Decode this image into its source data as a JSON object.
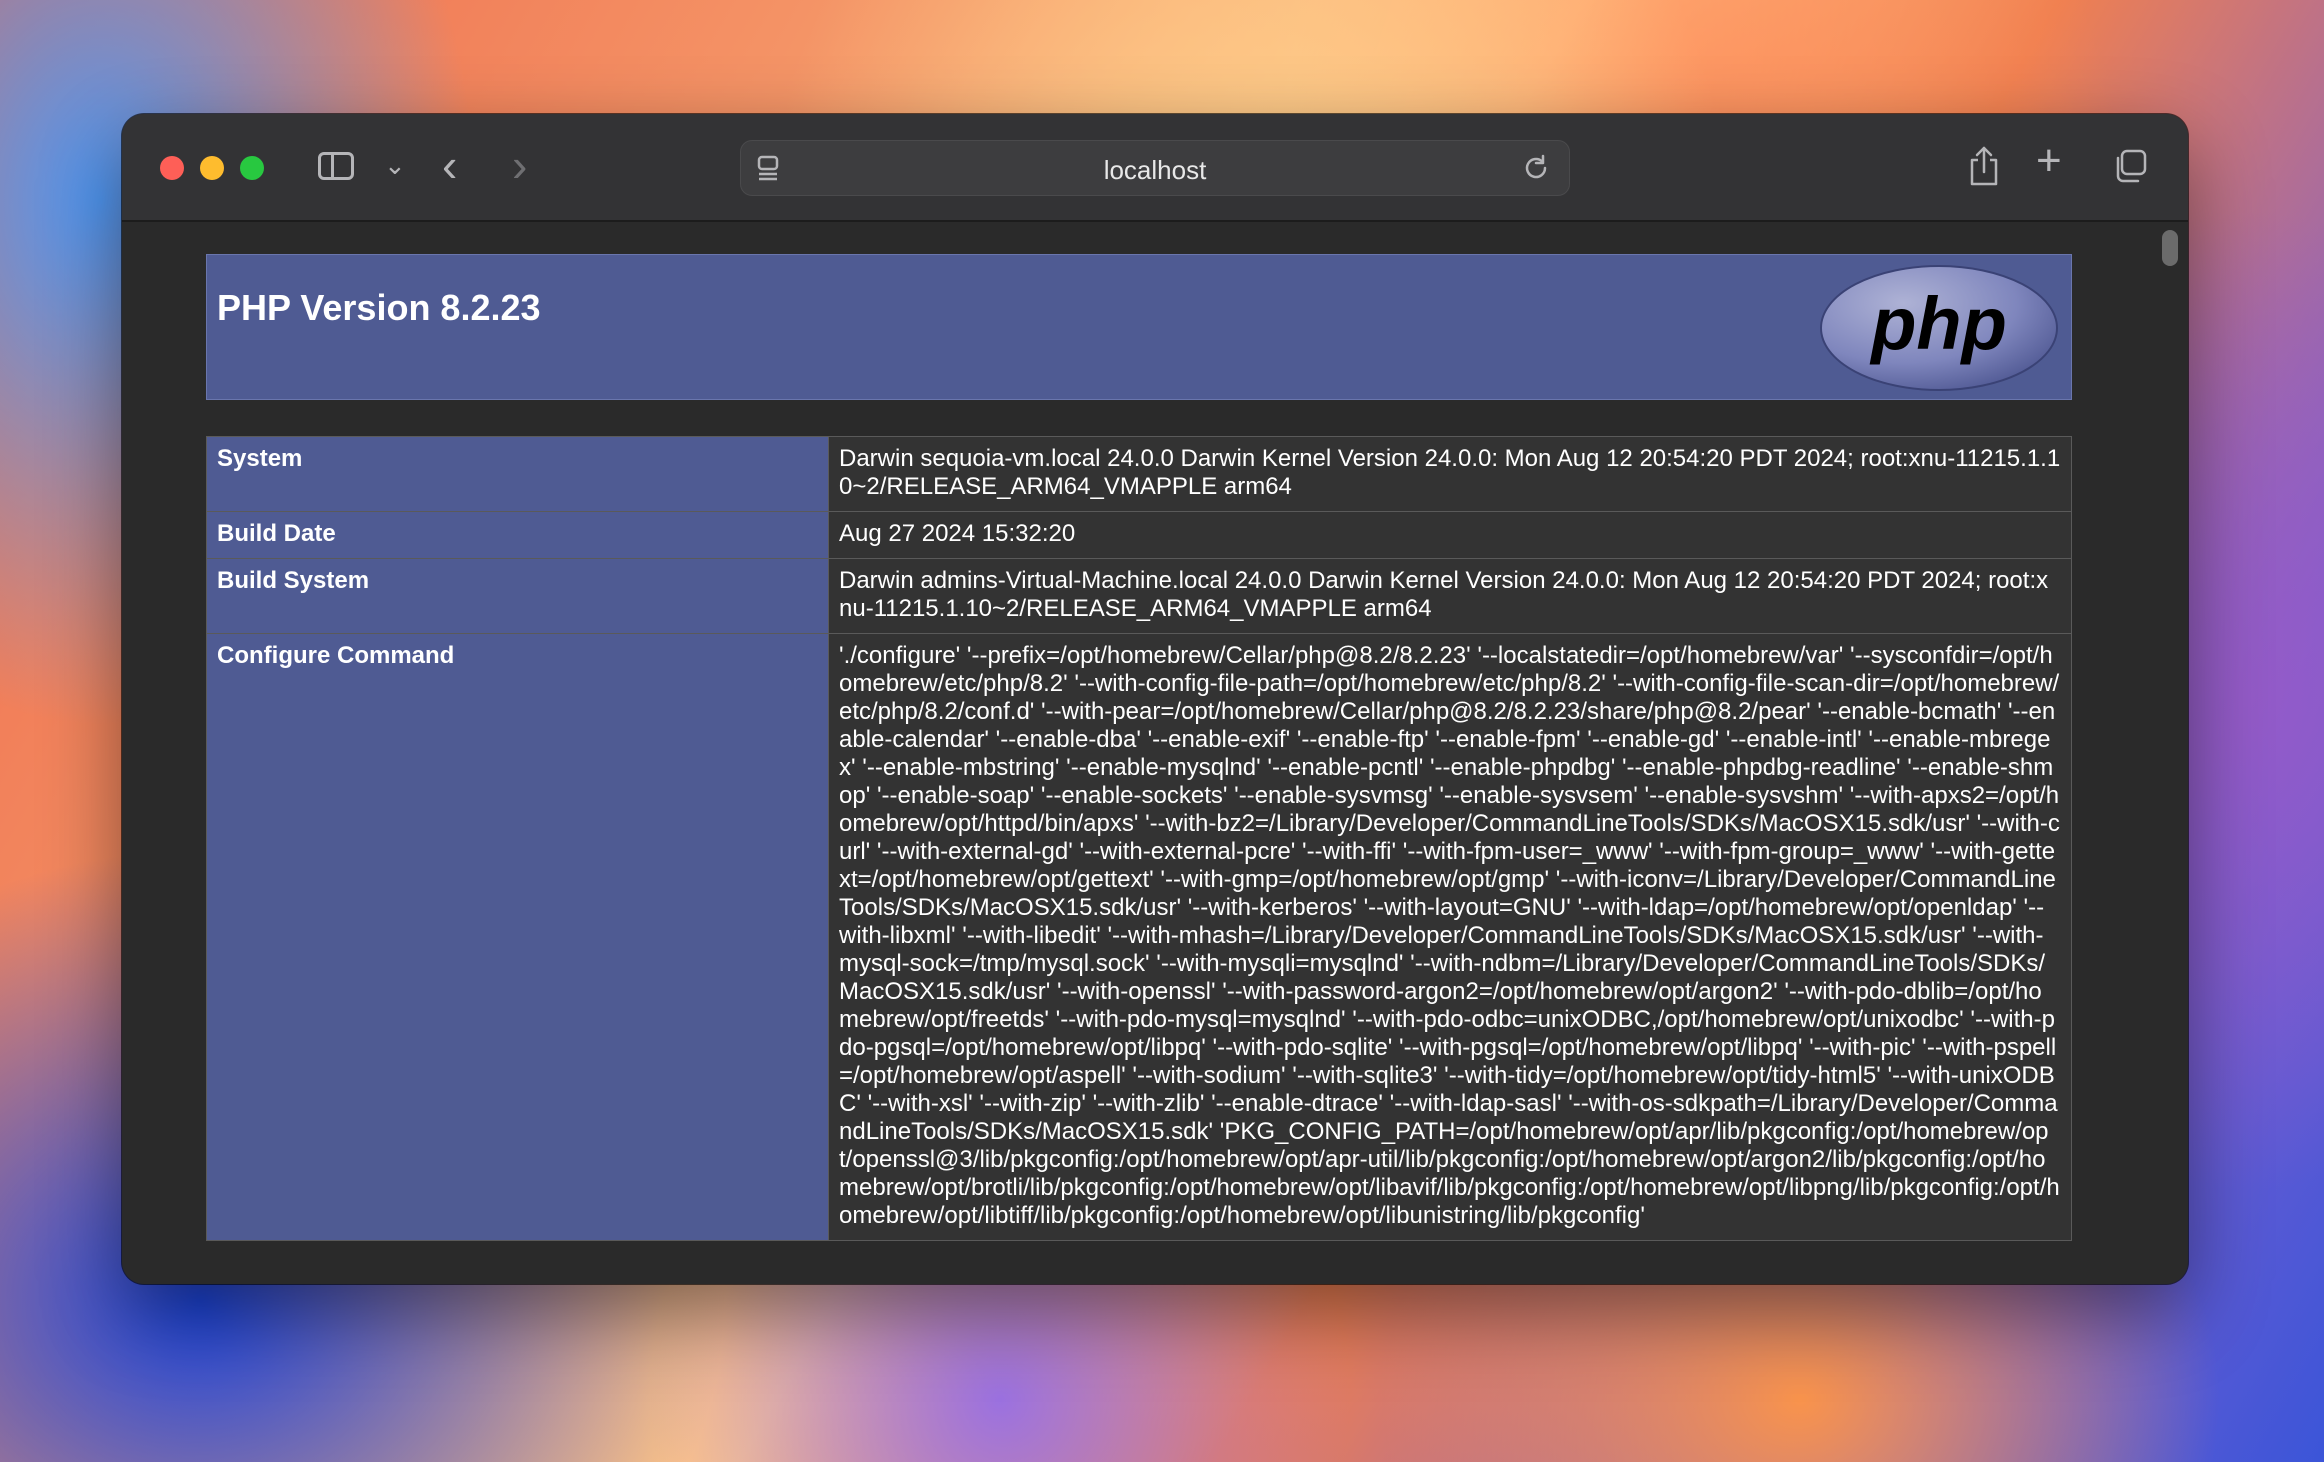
{
  "browser": {
    "url": "localhost"
  },
  "page": {
    "title": "PHP Version 8.2.23",
    "logo_text": "php",
    "rows": [
      {
        "key": "System",
        "value": "Darwin sequoia-vm.local 24.0.0 Darwin Kernel Version 24.0.0: Mon Aug 12 20:54:20 PDT 2024; root:xnu-11215.1.10~2/RELEASE_ARM64_VMAPPLE arm64"
      },
      {
        "key": "Build Date",
        "value": "Aug 27 2024 15:32:20"
      },
      {
        "key": "Build System",
        "value": "Darwin admins-Virtual-Machine.local 24.0.0 Darwin Kernel Version 24.0.0: Mon Aug 12 20:54:20 PDT 2024; root:xnu-11215.1.10~2/RELEASE_ARM64_VMAPPLE arm64"
      },
      {
        "key": "Configure Command",
        "value": "'./configure' '--prefix=/opt/homebrew/Cellar/php@8.2/8.2.23' '--localstatedir=/opt/homebrew/var' '--sysconfdir=/opt/homebrew/etc/php/8.2' '--with-config-file-path=/opt/homebrew/etc/php/8.2' '--with-config-file-scan-dir=/opt/homebrew/etc/php/8.2/conf.d' '--with-pear=/opt/homebrew/Cellar/php@8.2/8.2.23/share/php@8.2/pear' '--enable-bcmath' '--enable-calendar' '--enable-dba' '--enable-exif' '--enable-ftp' '--enable-fpm' '--enable-gd' '--enable-intl' '--enable-mbregex' '--enable-mbstring' '--enable-mysqlnd' '--enable-pcntl' '--enable-phpdbg' '--enable-phpdbg-readline' '--enable-shmop' '--enable-soap' '--enable-sockets' '--enable-sysvmsg' '--enable-sysvsem' '--enable-sysvshm' '--with-apxs2=/opt/homebrew/opt/httpd/bin/apxs' '--with-bz2=/Library/Developer/CommandLineTools/SDKs/MacOSX15.sdk/usr' '--with-curl' '--with-external-gd' '--with-external-pcre' '--with-ffi' '--with-fpm-user=_www' '--with-fpm-group=_www' '--with-gettext=/opt/homebrew/opt/gettext' '--with-gmp=/opt/homebrew/opt/gmp' '--with-iconv=/Library/Developer/CommandLineTools/SDKs/MacOSX15.sdk/usr' '--with-kerberos' '--with-layout=GNU' '--with-ldap=/opt/homebrew/opt/openldap' '--with-libxml' '--with-libedit' '--with-mhash=/Library/Developer/CommandLineTools/SDKs/MacOSX15.sdk/usr' '--with-mysql-sock=/tmp/mysql.sock' '--with-mysqli=mysqlnd' '--with-ndbm=/Library/Developer/CommandLineTools/SDKs/MacOSX15.sdk/usr' '--with-openssl' '--with-password-argon2=/opt/homebrew/opt/argon2' '--with-pdo-dblib=/opt/homebrew/opt/freetds' '--with-pdo-mysql=mysqlnd' '--with-pdo-odbc=unixODBC,/opt/homebrew/opt/unixodbc' '--with-pdo-pgsql=/opt/homebrew/opt/libpq' '--with-pdo-sqlite' '--with-pgsql=/opt/homebrew/opt/libpq' '--with-pic' '--with-pspell=/opt/homebrew/opt/aspell' '--with-sodium' '--with-sqlite3' '--with-tidy=/opt/homebrew/opt/tidy-html5' '--with-unixODBC' '--with-xsl' '--with-zip' '--with-zlib' '--enable-dtrace' '--with-ldap-sasl' '--with-os-sdkpath=/Library/Developer/CommandLineTools/SDKs/MacOSX15.sdk' 'PKG_CONFIG_PATH=/opt/homebrew/opt/apr/lib/pkgconfig:/opt/homebrew/opt/openssl@3/lib/pkgconfig:/opt/homebrew/opt/apr-util/lib/pkgconfig:/opt/homebrew/opt/argon2/lib/pkgconfig:/opt/homebrew/opt/brotli/lib/pkgconfig:/opt/homebrew/opt/libavif/lib/pkgconfig:/opt/homebrew/opt/libpng/lib/pkgconfig:/opt/homebrew/opt/libtiff/lib/pkgconfig:/opt/homebrew/opt/libunistring/lib/pkgconfig'"
      }
    ]
  }
}
